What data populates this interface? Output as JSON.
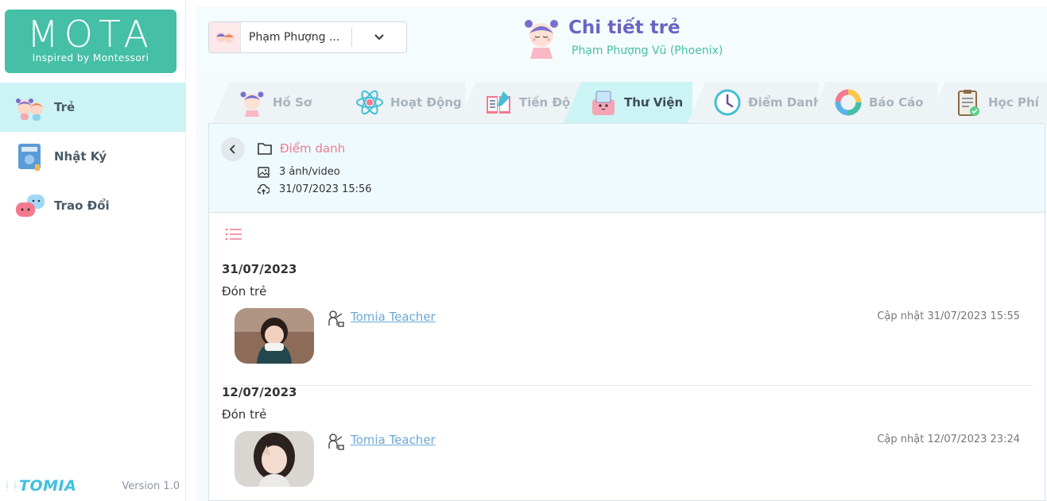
{
  "sidebar": {
    "logo_title": "MOTA",
    "logo_subtitle": "Inspired by Montessori",
    "items": [
      {
        "label": "Trẻ",
        "icon": "children-icon",
        "active": true
      },
      {
        "label": "Nhật Ký",
        "icon": "diary-icon",
        "active": false
      },
      {
        "label": "Trao Đổi",
        "icon": "chat-icon",
        "active": false
      }
    ],
    "brand": "TOMIA",
    "version": "Version 1.0"
  },
  "header": {
    "child_select_value": "Phạm Phượng ...",
    "title": "Chi tiết trẻ",
    "subtitle": "Phạm Phượng Vũ (Phoenix)"
  },
  "tabs": [
    {
      "label": "Hồ Sơ",
      "icon": "profile-icon"
    },
    {
      "label": "Hoạt Động",
      "icon": "activity-atom-icon"
    },
    {
      "label": "Tiến Độ",
      "icon": "progress-book-icon"
    },
    {
      "label": "Thư Viện",
      "icon": "library-icon",
      "active": true
    },
    {
      "label": "Điểm Danh",
      "icon": "attendance-clock-icon"
    },
    {
      "label": "Báo Cáo",
      "icon": "report-chart-icon"
    },
    {
      "label": "Học Phí",
      "icon": "tuition-clipboard-icon"
    }
  ],
  "album": {
    "folder_name": "Điểm danh",
    "media_count": "3 ảnh/video",
    "uploaded_at": "31/07/2023 15:56"
  },
  "entries": [
    {
      "date": "31/07/2023",
      "action": "Đón trẻ",
      "teacher": "Tomia Teacher",
      "updated": "Cập nhật 31/07/2023 15:55"
    },
    {
      "date": "12/07/2023",
      "action": "Đón trẻ",
      "teacher": "Tomia Teacher",
      "updated": "Cập nhật 12/07/2023 23:24"
    }
  ],
  "colors": {
    "brand_green": "#45bfa6",
    "active_tab": "#ccf4f5",
    "title_purple": "#6b63c4",
    "folder_pink": "#e77e8f",
    "link_blue": "#6aa8d8"
  }
}
